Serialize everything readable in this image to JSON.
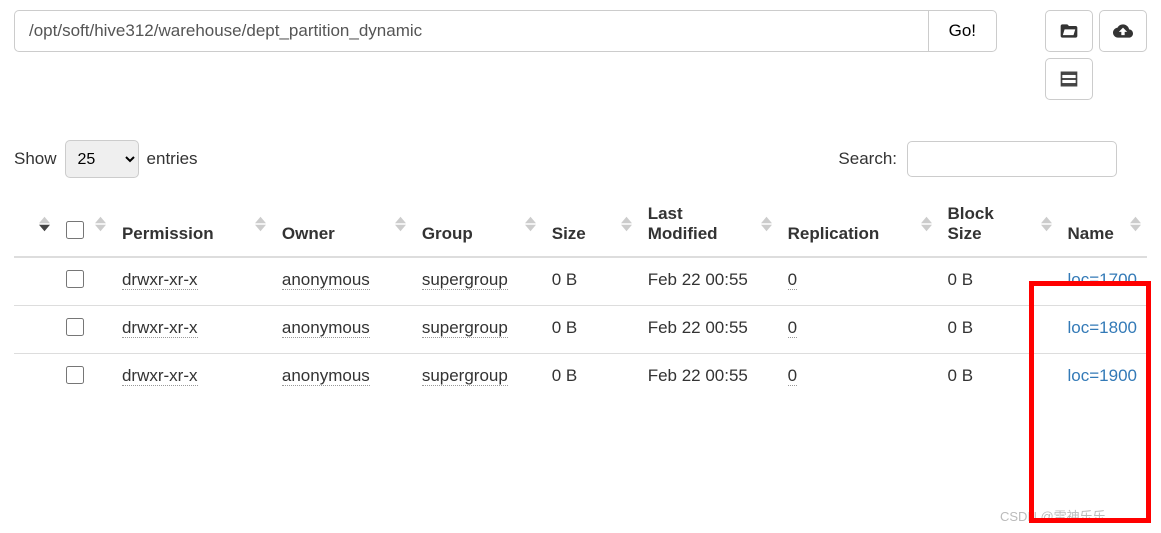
{
  "toolbar": {
    "path": "/opt/soft/hive312/warehouse/dept_partition_dynamic",
    "go_label": "Go!"
  },
  "controls": {
    "show_label": "Show",
    "entries_value": "25",
    "entries_label": "entries",
    "search_label": "Search:",
    "search_value": ""
  },
  "table": {
    "headers": {
      "permission": "Permission",
      "owner": "Owner",
      "group": "Group",
      "size": "Size",
      "last_modified": "Last Modified",
      "replication": "Replication",
      "block_size": "Block Size",
      "name": "Name"
    },
    "rows": [
      {
        "permission": "drwxr-xr-x",
        "owner": "anonymous",
        "group": "supergroup",
        "size": "0 B",
        "last_modified": "Feb 22 00:55",
        "replication": "0",
        "block_size": "0 B",
        "name": "loc=1700"
      },
      {
        "permission": "drwxr-xr-x",
        "owner": "anonymous",
        "group": "supergroup",
        "size": "0 B",
        "last_modified": "Feb 22 00:55",
        "replication": "0",
        "block_size": "0 B",
        "name": "loc=1800"
      },
      {
        "permission": "drwxr-xr-x",
        "owner": "anonymous",
        "group": "supergroup",
        "size": "0 B",
        "last_modified": "Feb 22 00:55",
        "replication": "0",
        "block_size": "0 B",
        "name": "loc=1900"
      }
    ]
  },
  "watermark": "CSDN @雷神乐乐"
}
